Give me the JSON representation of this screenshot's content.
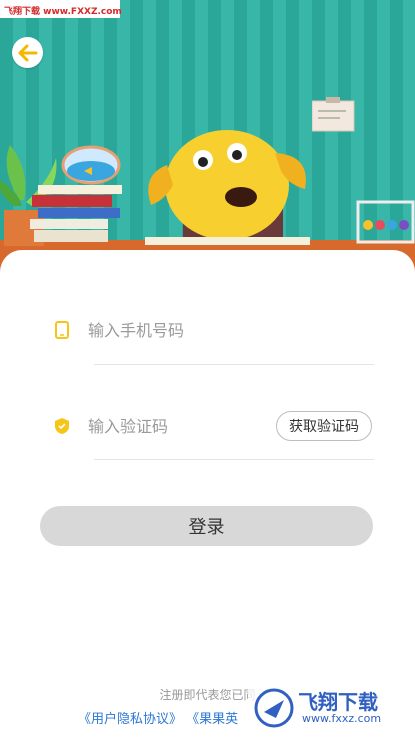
{
  "watermark_top": "飞翔下载 www.FXXZ.com",
  "phone_field": {
    "placeholder": "输入手机号码",
    "icon": "phone-icon"
  },
  "code_field": {
    "placeholder": "输入验证码",
    "icon": "shield-icon",
    "button_label": "获取验证码"
  },
  "login_button": "登录",
  "agreement": {
    "prefix": "注册即代表您已同",
    "privacy_link": "《用户隐私协议》",
    "terms_link": "《果果英"
  },
  "watermark_bottom": {
    "title": "飞翔下载",
    "url": "www.fxxz.com"
  },
  "colors": {
    "wall": "#2ba79a",
    "floor": "#d8692d",
    "accent_yellow": "#f5c518",
    "link": "#2b78d6"
  }
}
